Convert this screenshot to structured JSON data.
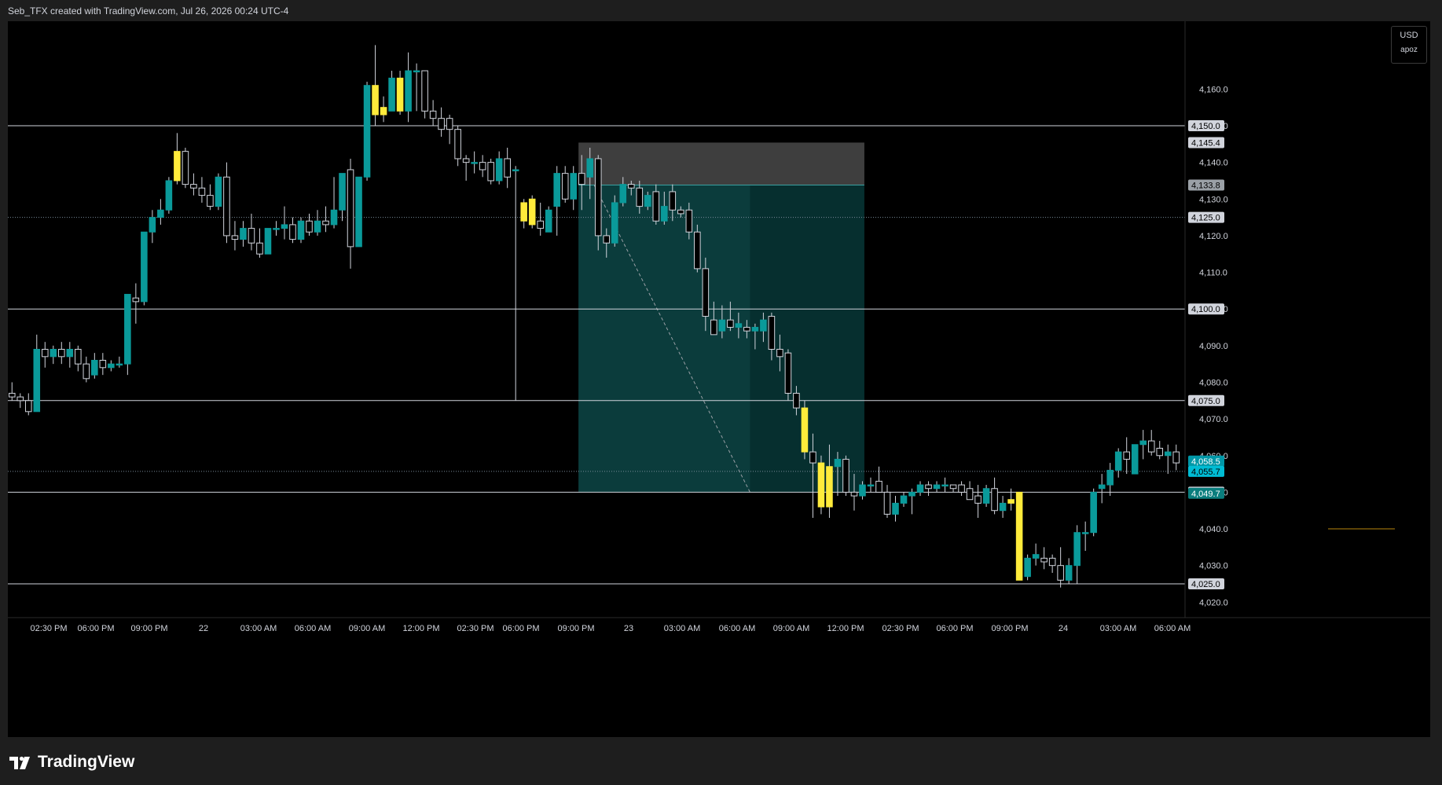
{
  "header": {
    "attribution": "Seb_TFX created with TradingView.com, Jul 26, 2026 00:24 UTC-4"
  },
  "scale": {
    "currency": "USD",
    "sublabel": "apoz"
  },
  "footer": {
    "brand": "TradingView"
  },
  "colors": {
    "background": "#000000",
    "bull": "#0a9a9a",
    "bear": "#000000",
    "highlight": "#ffeb3b",
    "level_line": "#d1d4dc",
    "target_zone": "#0b3c3c",
    "stop_zone": "#3e3e3e",
    "last_price": "#0097a7"
  },
  "chart_data": {
    "type": "candlestick",
    "symbol": "",
    "ylim": [
      4016,
      4174
    ],
    "x_tick_labels": [
      "02:30 PM",
      "06:00 PM",
      "09:00 PM",
      "22",
      "03:00 AM",
      "06:00 AM",
      "09:00 AM",
      "12:00 PM",
      "02:30 PM",
      "06:00 PM",
      "09:00 PM",
      "23",
      "03:00 AM",
      "06:00 AM",
      "09:00 AM",
      "12:00 PM",
      "02:30 PM",
      "06:00 PM",
      "09:00 PM",
      "24",
      "03:00 AM",
      "06:00 AM"
    ],
    "y_ticks": [
      4020,
      4030,
      4040,
      4050,
      4060,
      4070,
      4080,
      4090,
      4100,
      4110,
      4120,
      4130,
      4140,
      4150,
      4160
    ],
    "horizontal_levels": [
      4150,
      4100,
      4075,
      4050,
      4025
    ],
    "dotted_levels": [
      4125,
      4055.7
    ],
    "price_tags": [
      {
        "label": "4,150.0",
        "value": 4150,
        "style": "level"
      },
      {
        "label": "4,145.4",
        "value": 4145.4,
        "style": "level"
      },
      {
        "label": "4,133.8",
        "value": 4133.8,
        "style": "entry"
      },
      {
        "label": "4,125.0",
        "value": 4125,
        "style": "level"
      },
      {
        "label": "4,100.0",
        "value": 4100,
        "style": "level"
      },
      {
        "label": "4,075.0",
        "value": 4075,
        "style": "level"
      },
      {
        "label": "4,058.5",
        "value": 4058.5,
        "style": "current"
      },
      {
        "label": "4,055.7",
        "value": 4055.7,
        "style": "last"
      },
      {
        "label": "4,050.0",
        "value": 4050,
        "style": "level"
      },
      {
        "label": "4,049.7",
        "value": 4049.7,
        "style": "target"
      },
      {
        "label": "4,025.0",
        "value": 4025,
        "style": "level"
      }
    ],
    "position": {
      "side": "short",
      "entry": 4133.8,
      "stop": 4145.4,
      "target": 4050
    },
    "candles": [
      {
        "o": 4077,
        "h": 4080,
        "l": 4075,
        "c": 4076
      },
      {
        "o": 4076,
        "h": 4077,
        "l": 4073,
        "c": 4075
      },
      {
        "o": 4075,
        "h": 4077,
        "l": 4071,
        "c": 4072
      },
      {
        "o": 4072,
        "h": 4093,
        "l": 4072,
        "c": 4089
      },
      {
        "o": 4089,
        "h": 4091,
        "l": 4084,
        "c": 4087
      },
      {
        "o": 4087,
        "h": 4090,
        "l": 4085,
        "c": 4089
      },
      {
        "o": 4089,
        "h": 4091,
        "l": 4085,
        "c": 4087
      },
      {
        "o": 4087,
        "h": 4091,
        "l": 4084,
        "c": 4089
      },
      {
        "o": 4089,
        "h": 4090,
        "l": 4083,
        "c": 4085
      },
      {
        "o": 4085,
        "h": 4087,
        "l": 4080,
        "c": 4081
      },
      {
        "o": 4082,
        "h": 4088,
        "l": 4081,
        "c": 4086
      },
      {
        "o": 4086,
        "h": 4088,
        "l": 4082,
        "c": 4084
      },
      {
        "o": 4084,
        "h": 4086,
        "l": 4083,
        "c": 4085
      },
      {
        "o": 4085,
        "h": 4087,
        "l": 4084,
        "c": 4085
      },
      {
        "o": 4085,
        "h": 4104,
        "l": 4082,
        "c": 4104
      },
      {
        "o": 4103,
        "h": 4107,
        "l": 4096,
        "c": 4102
      },
      {
        "o": 4102,
        "h": 4121,
        "l": 4101,
        "c": 4121
      },
      {
        "o": 4121,
        "h": 4127,
        "l": 4118,
        "c": 4125
      },
      {
        "o": 4125,
        "h": 4130,
        "l": 4123,
        "c": 4127
      },
      {
        "o": 4127,
        "h": 4136,
        "l": 4126,
        "c": 4135
      },
      {
        "o": 4135,
        "h": 4148,
        "l": 4134,
        "c": 4143
      },
      {
        "o": 4143,
        "h": 4144,
        "l": 4133,
        "c": 4134
      },
      {
        "o": 4134,
        "h": 4137,
        "l": 4131,
        "c": 4133
      },
      {
        "o": 4133,
        "h": 4136,
        "l": 4129,
        "c": 4131
      },
      {
        "o": 4131,
        "h": 4134,
        "l": 4127,
        "c": 4128
      },
      {
        "o": 4128,
        "h": 4137,
        "l": 4127,
        "c": 4136
      },
      {
        "o": 4136,
        "h": 4140,
        "l": 4118,
        "c": 4120
      },
      {
        "o": 4120,
        "h": 4124,
        "l": 4116,
        "c": 4119
      },
      {
        "o": 4119,
        "h": 4124,
        "l": 4117,
        "c": 4122
      },
      {
        "o": 4122,
        "h": 4126,
        "l": 4116,
        "c": 4118
      },
      {
        "o": 4118,
        "h": 4122,
        "l": 4114,
        "c": 4115
      },
      {
        "o": 4115,
        "h": 4122,
        "l": 4115,
        "c": 4122
      },
      {
        "o": 4122,
        "h": 4124,
        "l": 4120,
        "c": 4122
      },
      {
        "o": 4122,
        "h": 4128,
        "l": 4119,
        "c": 4123
      },
      {
        "o": 4123,
        "h": 4125,
        "l": 4118,
        "c": 4119
      },
      {
        "o": 4119,
        "h": 4125,
        "l": 4118,
        "c": 4124
      },
      {
        "o": 4124,
        "h": 4126,
        "l": 4120,
        "c": 4121
      },
      {
        "o": 4121,
        "h": 4127,
        "l": 4120,
        "c": 4124
      },
      {
        "o": 4124,
        "h": 4128,
        "l": 4121,
        "c": 4123
      },
      {
        "o": 4123,
        "h": 4136,
        "l": 4122,
        "c": 4127
      },
      {
        "o": 4127,
        "h": 4137,
        "l": 4124,
        "c": 4137
      },
      {
        "o": 4138,
        "h": 4141,
        "l": 4111,
        "c": 4117
      },
      {
        "o": 4117,
        "h": 4136,
        "l": 4117,
        "c": 4136
      },
      {
        "o": 4136,
        "h": 4162,
        "l": 4135,
        "c": 4161
      },
      {
        "o": 4161,
        "h": 4172,
        "l": 4150,
        "c": 4153
      },
      {
        "o": 4153,
        "h": 4158,
        "l": 4151,
        "c": 4155
      },
      {
        "o": 4154,
        "h": 4165,
        "l": 4154,
        "c": 4163
      },
      {
        "o": 4163,
        "h": 4165,
        "l": 4153,
        "c": 4154
      },
      {
        "o": 4154,
        "h": 4170,
        "l": 4151,
        "c": 4165
      },
      {
        "o": 4165,
        "h": 4167,
        "l": 4154,
        "c": 4165
      },
      {
        "o": 4165,
        "h": 4159,
        "l": 4152,
        "c": 4154
      },
      {
        "o": 4154,
        "h": 4157,
        "l": 4150,
        "c": 4152
      },
      {
        "o": 4152,
        "h": 4155,
        "l": 4147,
        "c": 4149
      },
      {
        "o": 4152,
        "h": 4153,
        "l": 4145,
        "c": 4149
      },
      {
        "o": 4149,
        "h": 4150,
        "l": 4139,
        "c": 4141
      },
      {
        "o": 4141,
        "h": 4142,
        "l": 4135,
        "c": 4140
      },
      {
        "o": 4140,
        "h": 4143,
        "l": 4137,
        "c": 4140
      },
      {
        "o": 4140,
        "h": 4142,
        "l": 4136,
        "c": 4138
      },
      {
        "o": 4140,
        "h": 4141,
        "l": 4134,
        "c": 4135
      },
      {
        "o": 4135,
        "h": 4143,
        "l": 4134,
        "c": 4141
      },
      {
        "o": 4141,
        "h": 4144,
        "l": 4133,
        "c": 4136
      },
      {
        "o": 4138,
        "h": 4139,
        "l": 4075,
        "c": 4138
      },
      {
        "o": 4129,
        "h": 4130,
        "l": 4122,
        "c": 4124
      },
      {
        "o": 4130,
        "h": 4131,
        "l": 4122,
        "c": 4123
      },
      {
        "o": 4124,
        "h": 4129,
        "l": 4120,
        "c": 4122
      },
      {
        "o": 4121,
        "h": 4128,
        "l": 4121,
        "c": 4127
      },
      {
        "o": 4128,
        "h": 4139,
        "l": 4120,
        "c": 4137
      },
      {
        "o": 4137,
        "h": 4139,
        "l": 4129,
        "c": 4130
      },
      {
        "o": 4130,
        "h": 4139,
        "l": 4127,
        "c": 4137
      },
      {
        "o": 4137,
        "h": 4142,
        "l": 4127,
        "c": 4134
      },
      {
        "o": 4136,
        "h": 4144,
        "l": 4130,
        "c": 4141
      },
      {
        "o": 4141,
        "h": 4142,
        "l": 4116,
        "c": 4120
      },
      {
        "o": 4120,
        "h": 4122,
        "l": 4114,
        "c": 4118
      },
      {
        "o": 4118,
        "h": 4131,
        "l": 4117,
        "c": 4129
      },
      {
        "o": 4129,
        "h": 4136,
        "l": 4128,
        "c": 4134
      },
      {
        "o": 4134,
        "h": 4135,
        "l": 4131,
        "c": 4133
      },
      {
        "o": 4133,
        "h": 4135,
        "l": 4126,
        "c": 4128
      },
      {
        "o": 4128,
        "h": 4132,
        "l": 4127,
        "c": 4131
      },
      {
        "o": 4132,
        "h": 4134,
        "l": 4123,
        "c": 4124
      },
      {
        "o": 4124,
        "h": 4132,
        "l": 4123,
        "c": 4128
      },
      {
        "o": 4132,
        "h": 4134,
        "l": 4124,
        "c": 4127
      },
      {
        "o": 4127,
        "h": 4128,
        "l": 4125,
        "c": 4126
      },
      {
        "o": 4127,
        "h": 4129,
        "l": 4119,
        "c": 4121
      },
      {
        "o": 4121,
        "h": 4123,
        "l": 4110,
        "c": 4111
      },
      {
        "o": 4111,
        "h": 4114,
        "l": 4094,
        "c": 4098
      },
      {
        "o": 4097,
        "h": 4102,
        "l": 4093,
        "c": 4093
      },
      {
        "o": 4094,
        "h": 4101,
        "l": 4092,
        "c": 4097
      },
      {
        "o": 4097,
        "h": 4102,
        "l": 4094,
        "c": 4095
      },
      {
        "o": 4095,
        "h": 4099,
        "l": 4092,
        "c": 4096
      },
      {
        "o": 4095,
        "h": 4097,
        "l": 4092,
        "c": 4094
      },
      {
        "o": 4094,
        "h": 4096,
        "l": 4089,
        "c": 4095
      },
      {
        "o": 4094,
        "h": 4099,
        "l": 4091,
        "c": 4097
      },
      {
        "o": 4098,
        "h": 4099,
        "l": 4086,
        "c": 4089
      },
      {
        "o": 4089,
        "h": 4093,
        "l": 4083,
        "c": 4087
      },
      {
        "o": 4088,
        "h": 4089,
        "l": 4075,
        "c": 4077
      },
      {
        "o": 4077,
        "h": 4079,
        "l": 4071,
        "c": 4073
      },
      {
        "o": 4073,
        "h": 4075,
        "l": 4059,
        "c": 4061
      },
      {
        "o": 4061,
        "h": 4066,
        "l": 4043,
        "c": 4058
      },
      {
        "o": 4058,
        "h": 4060,
        "l": 4044,
        "c": 4046
      },
      {
        "o": 4046,
        "h": 4063,
        "l": 4043,
        "c": 4057
      },
      {
        "o": 4057,
        "h": 4061,
        "l": 4049,
        "c": 4059
      },
      {
        "o": 4059,
        "h": 4060,
        "l": 4049,
        "c": 4050
      },
      {
        "o": 4050,
        "h": 4055,
        "l": 4045,
        "c": 4049
      },
      {
        "o": 4049,
        "h": 4053,
        "l": 4048,
        "c": 4052
      },
      {
        "o": 4052,
        "h": 4054,
        "l": 4050,
        "c": 4052
      },
      {
        "o": 4053,
        "h": 4057,
        "l": 4050,
        "c": 4050
      },
      {
        "o": 4050,
        "h": 4052,
        "l": 4043,
        "c": 4044
      },
      {
        "o": 4044,
        "h": 4049,
        "l": 4042,
        "c": 4047
      },
      {
        "o": 4047,
        "h": 4050,
        "l": 4046,
        "c": 4049
      },
      {
        "o": 4049,
        "h": 4051,
        "l": 4044,
        "c": 4050
      },
      {
        "o": 4050,
        "h": 4053,
        "l": 4049,
        "c": 4052
      },
      {
        "o": 4052,
        "h": 4053,
        "l": 4049,
        "c": 4051
      },
      {
        "o": 4051,
        "h": 4053,
        "l": 4050,
        "c": 4052
      },
      {
        "o": 4052,
        "h": 4054,
        "l": 4050,
        "c": 4052
      },
      {
        "o": 4052,
        "h": 4052,
        "l": 4050,
        "c": 4051
      },
      {
        "o": 4052,
        "h": 4053,
        "l": 4049,
        "c": 4050
      },
      {
        "o": 4051,
        "h": 4053,
        "l": 4048,
        "c": 4048
      },
      {
        "o": 4049,
        "h": 4052,
        "l": 4043,
        "c": 4047
      },
      {
        "o": 4047,
        "h": 4052,
        "l": 4046,
        "c": 4051
      },
      {
        "o": 4051,
        "h": 4054,
        "l": 4044,
        "c": 4045
      },
      {
        "o": 4045,
        "h": 4049,
        "l": 4043,
        "c": 4047
      },
      {
        "o": 4047,
        "h": 4051,
        "l": 4045,
        "c": 4048
      },
      {
        "o": 4050,
        "h": 4050,
        "l": 4026,
        "c": 4026
      },
      {
        "o": 4027,
        "h": 4033,
        "l": 4026,
        "c": 4032
      },
      {
        "o": 4032,
        "h": 4036,
        "l": 4030,
        "c": 4033
      },
      {
        "o": 4032,
        "h": 4035,
        "l": 4029,
        "c": 4031
      },
      {
        "o": 4032,
        "h": 4033,
        "l": 4028,
        "c": 4030
      },
      {
        "o": 4030,
        "h": 4035,
        "l": 4024,
        "c": 4026
      },
      {
        "o": 4026,
        "h": 4032,
        "l": 4025,
        "c": 4030
      },
      {
        "o": 4030,
        "h": 4041,
        "l": 4025,
        "c": 4039
      },
      {
        "o": 4039,
        "h": 4042,
        "l": 4034,
        "c": 4039
      },
      {
        "o": 4039,
        "h": 4051,
        "l": 4038,
        "c": 4050
      },
      {
        "o": 4051,
        "h": 4055,
        "l": 4047,
        "c": 4052
      },
      {
        "o": 4052,
        "h": 4058,
        "l": 4049,
        "c": 4056
      },
      {
        "o": 4056,
        "h": 4062,
        "l": 4054,
        "c": 4061
      },
      {
        "o": 4061,
        "h": 4065,
        "l": 4055,
        "c": 4059
      },
      {
        "o": 4055,
        "h": 4063,
        "l": 4055,
        "c": 4063
      },
      {
        "o": 4063,
        "h": 4067,
        "l": 4059,
        "c": 4064
      },
      {
        "o": 4064,
        "h": 4067,
        "l": 4060,
        "c": 4061
      },
      {
        "o": 4062,
        "h": 4064,
        "l": 4059,
        "c": 4060
      },
      {
        "o": 4060,
        "h": 4063,
        "l": 4055,
        "c": 4061
      },
      {
        "o": 4061,
        "h": 4063,
        "l": 4056,
        "c": 4058
      }
    ]
  }
}
